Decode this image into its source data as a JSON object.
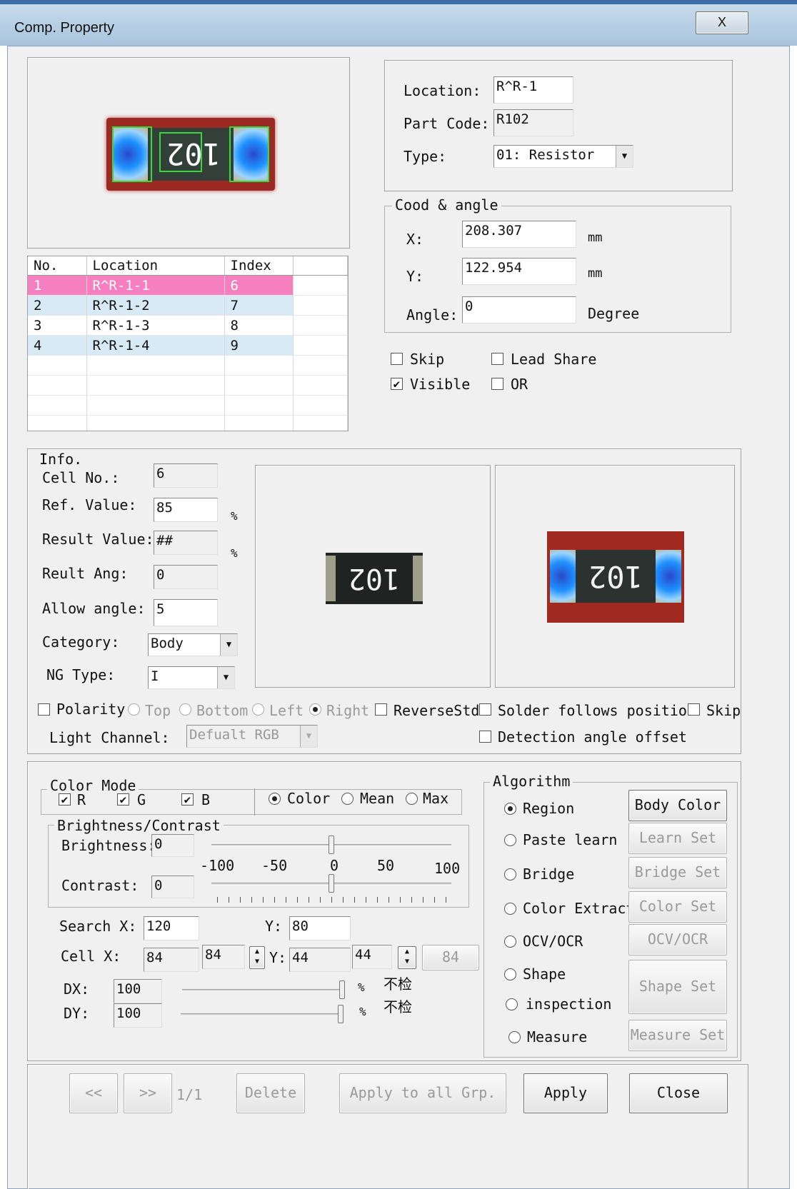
{
  "window": {
    "title": "Comp. Property",
    "close_glyph": "X"
  },
  "part": {
    "location_label": "Location:",
    "location_value": "R^R-1",
    "part_code_label": "Part Code:",
    "part_code_value": "R102",
    "type_label": "Type:",
    "type_value": "01: Resistor"
  },
  "coord": {
    "group_label": "Cood & angle",
    "x_label": "X:",
    "x_value": "208.307",
    "x_unit": "mm",
    "y_label": "Y:",
    "y_value": "122.954",
    "y_unit": "mm",
    "angle_label": "Angle:",
    "angle_value": "0",
    "angle_unit": "Degree"
  },
  "flags": {
    "skip": {
      "label": "Skip",
      "checked": false
    },
    "lead_share": {
      "label": "Lead Share",
      "checked": false
    },
    "visible": {
      "label": "Visible",
      "checked": true
    },
    "or": {
      "label": "OR",
      "checked": false
    }
  },
  "table": {
    "headers": [
      "No.",
      "Location",
      "Index"
    ],
    "rows": [
      {
        "no": "1",
        "location": "R^R-1-1",
        "index": "6"
      },
      {
        "no": "2",
        "location": "R^R-1-2",
        "index": "7"
      },
      {
        "no": "3",
        "location": "R^R-1-3",
        "index": "8"
      },
      {
        "no": "4",
        "location": "R^R-1-4",
        "index": "9"
      }
    ]
  },
  "chip_marking": "102",
  "info": {
    "group_label": "Info.",
    "cell_no_label": "Cell No.:",
    "cell_no_value": "6",
    "ref_value_label": "Ref. Value:",
    "ref_value_value": "85",
    "ref_unit": "%",
    "result_value_label": "Result Value:",
    "result_value_value": "##",
    "result_unit": "%",
    "result_ang_label": "Reult Ang:",
    "result_ang_value": "0",
    "allow_angle_label": "Allow angle:",
    "allow_angle_value": "5",
    "category_label": "Category:",
    "category_value": "Body",
    "ng_type_label": "NG Type:",
    "ng_type_value": "I"
  },
  "options": {
    "polarity": "Polarity",
    "top": "Top",
    "bottom": "Bottom",
    "left": "Left",
    "right": "Right",
    "reverse_std": "ReverseStd",
    "solder_follows": "Solder follows position",
    "skip": "Skip",
    "light_channel_label": "Light Channel:",
    "light_channel_value": "Defualt RGB",
    "detection_angle_offset": "Detection angle offset"
  },
  "color_mode": {
    "group_label": "Color Mode",
    "r": "R",
    "g": "G",
    "b": "B",
    "color": "Color",
    "mean": "Mean",
    "max": "Max"
  },
  "brightness": {
    "group_label": "Brightness/Contrast",
    "brightness_label": "Brightness:",
    "brightness_value": "0",
    "contrast_label": "Contrast:",
    "contrast_value": "0",
    "scale": [
      "-100",
      "-50",
      "0",
      "50",
      "100"
    ],
    "brightness_level": 0,
    "contrast_level": 0
  },
  "search": {
    "search_x_label": "Search X:",
    "search_x_value": "120",
    "y_label": "Y:",
    "y_value": "80",
    "cell_x_label": "Cell X:",
    "cell_x_value": "84",
    "cell_x_spin": "84",
    "cell_y_label": "Y:",
    "cell_y_value": "44",
    "cell_y_spin": "44",
    "disabled_value": "84",
    "dx_label": "DX:",
    "dx_value": "100",
    "dx_unit": "%",
    "dx_note": "不检",
    "dy_label": "DY:",
    "dy_value": "100",
    "dy_unit": "%",
    "dy_note": "不检"
  },
  "algorithm": {
    "group_label": "Algorithm",
    "region": "Region",
    "body_color": "Body Color",
    "paste_learn": "Paste learn",
    "learn_set": "Learn Set",
    "bridge": "Bridge",
    "bridge_set": "Bridge Set",
    "color_extract": "Color Extract",
    "color_set": "Color Set",
    "ocv_ocr": "OCV/OCR",
    "ocv_ocr_btn": "OCV/OCR",
    "shape": "Shape",
    "inspection": "inspection",
    "shape_set": "Shape Set",
    "measure": "Measure",
    "measure_set": "Measure Set"
  },
  "footer": {
    "prev": "<<",
    "next": ">>",
    "page": "1/1",
    "delete": "Delete",
    "apply_all": "Apply to all Grp.",
    "apply": "Apply",
    "close": "Close"
  }
}
